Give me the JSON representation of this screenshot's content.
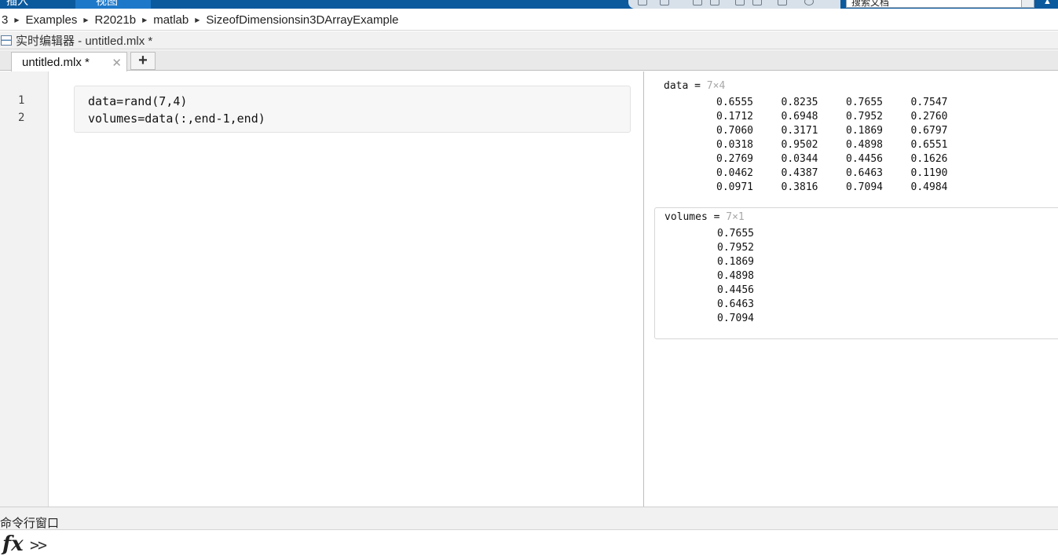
{
  "ribbon": {
    "tabs": [
      "插入",
      "视图"
    ],
    "search_value": "搜索文档"
  },
  "breadcrumb": {
    "items": [
      "3",
      "Examples",
      "R2021b",
      "matlab",
      "SizeofDimensionsin3DArrayExample"
    ]
  },
  "editor": {
    "title": "实时编辑器 - untitled.mlx *",
    "tab_label": "untitled.mlx *",
    "add_tab_label": "+",
    "close_label": "✕",
    "line_numbers": [
      "1",
      "2"
    ],
    "code_lines": [
      "data=rand(7,4)",
      "volumes=data(:,end-1,end)"
    ]
  },
  "output": {
    "data": {
      "name": "data",
      "eq": " = ",
      "dims": "7×4",
      "rows": [
        [
          "0.6555",
          "0.8235",
          "0.7655",
          "0.7547"
        ],
        [
          "0.1712",
          "0.6948",
          "0.7952",
          "0.2760"
        ],
        [
          "0.7060",
          "0.3171",
          "0.1869",
          "0.6797"
        ],
        [
          "0.0318",
          "0.9502",
          "0.4898",
          "0.6551"
        ],
        [
          "0.2769",
          "0.0344",
          "0.4456",
          "0.1626"
        ],
        [
          "0.0462",
          "0.4387",
          "0.6463",
          "0.1190"
        ],
        [
          "0.0971",
          "0.3816",
          "0.7094",
          "0.4984"
        ]
      ]
    },
    "volumes": {
      "name": "volumes",
      "eq": " = ",
      "dims": "7×1",
      "rows": [
        [
          "0.7655"
        ],
        [
          "0.7952"
        ],
        [
          "0.1869"
        ],
        [
          "0.4898"
        ],
        [
          "0.4456"
        ],
        [
          "0.6463"
        ],
        [
          "0.7094"
        ]
      ]
    }
  },
  "command_window": {
    "title": "命令行窗口",
    "fx_label": "fx",
    "prompt": ">>"
  }
}
